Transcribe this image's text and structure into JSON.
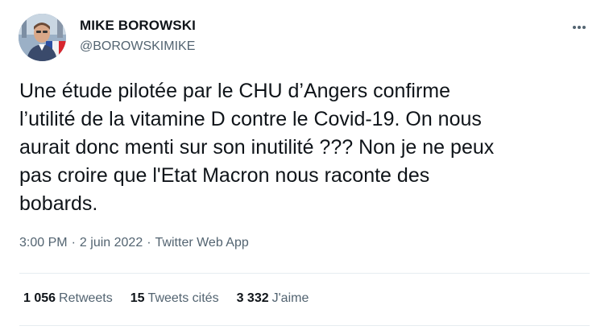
{
  "author": {
    "display_name": "MIKE BOROWSKI",
    "handle": "@BOROWSKIMIKE"
  },
  "tweet": {
    "text": "Une étude pilotée par le CHU d’Angers confirme\nl’utilité de la vitamine D contre le Covid-19. On nous\naurait donc menti sur son inutilité ??? Non je ne peux\npas croire que l'Etat Macron nous raconte des\nbobards.",
    "time": "3:00 PM",
    "separator": "·",
    "date": "2 juin 2022",
    "source": "Twitter Web App"
  },
  "stats": {
    "retweets_count": "1 056",
    "retweets_label": "Retweets",
    "quotes_count": "15",
    "quotes_label": "Tweets cités",
    "likes_count": "3 332",
    "likes_label": "J'aime"
  },
  "icons": {
    "more": "more-horizontal-icon"
  },
  "colors": {
    "primary_text": "#0f1419",
    "secondary_text": "#536471",
    "divider": "#e6ecf0"
  }
}
